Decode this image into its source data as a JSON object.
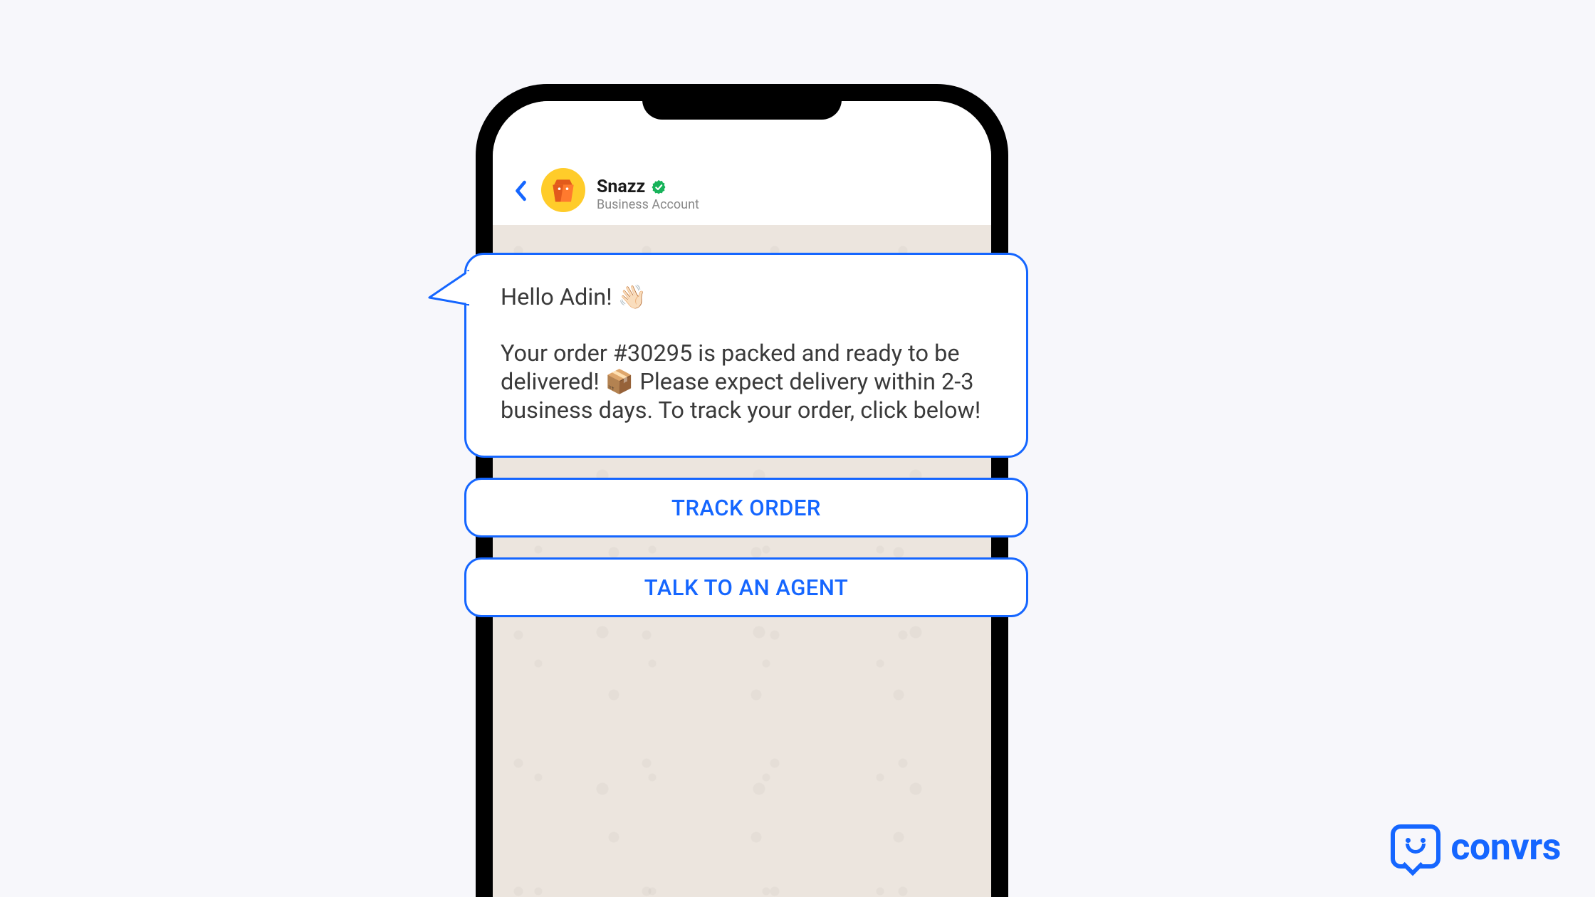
{
  "header": {
    "business_name": "Snazz",
    "subtitle": "Business Account"
  },
  "message": {
    "greeting": "Hello Adin! 👋🏻",
    "body": "Your order #30295 is packed and ready to be delivered! 📦 Please expect delivery within 2-3 business days. To track your order, click below!"
  },
  "actions": {
    "track_order": "TRACK ORDER",
    "talk_to_agent": "TALK TO AN AGENT"
  },
  "brand": {
    "name": "convrs"
  }
}
